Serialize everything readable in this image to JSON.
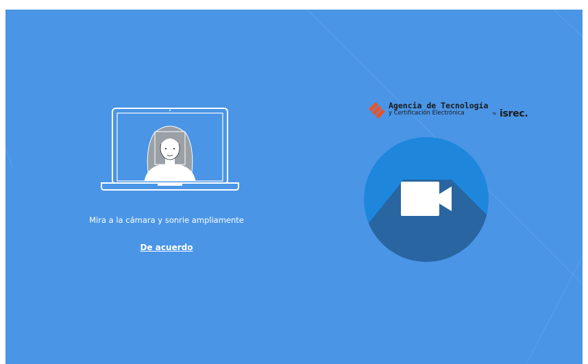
{
  "instruction": {
    "text": "Mira a la cámara y sonrie ampliamente"
  },
  "agree": {
    "label": "De acuerdo"
  },
  "logo": {
    "title": "Agencia de Tecnología",
    "subtitle": "y Certificación Electrónica",
    "by": "by",
    "brand": "isrec."
  },
  "icons": {
    "laptop": "laptop-face-illustration",
    "logo": "agency-logo-icon",
    "camera": "video-camera-icon"
  },
  "colors": {
    "background": "#4a95e6",
    "circle": "#1e87dc",
    "shadow": "#2b5f97",
    "logo_orange": "#e8532b"
  }
}
